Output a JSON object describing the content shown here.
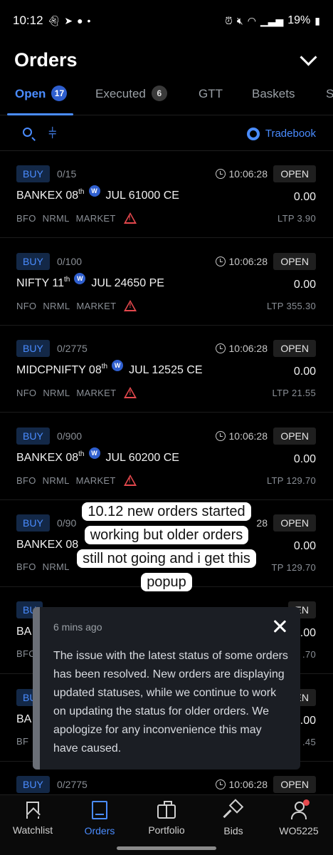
{
  "status_bar": {
    "time": "10:12",
    "battery": "19%",
    "left_icons": [
      "snapchat-icon",
      "telegram-icon",
      "chat-icon",
      "dot-icon"
    ],
    "right_icons": [
      "alarm-icon",
      "mute-icon",
      "wifi-icon",
      "volte-icon",
      "signal-icon",
      "battery-icon"
    ]
  },
  "header": {
    "title": "Orders"
  },
  "tabs": [
    {
      "label": "Open",
      "count": "17"
    },
    {
      "label": "Executed",
      "count": "6"
    },
    {
      "label": "GTT"
    },
    {
      "label": "Baskets"
    },
    {
      "label": "S"
    }
  ],
  "toolbar": {
    "tradebook_label": "Tradebook"
  },
  "orders": [
    {
      "side": "BUY",
      "qty": "0/15",
      "time": "10:06:28",
      "status": "OPEN",
      "symbol": "BANKEX 08",
      "suffix": "th",
      "badge": "W",
      "contract": "JUL 61000 CE",
      "price": "0.00",
      "exchange": "BFO",
      "product": "NRML",
      "type": "MARKET",
      "ltp_label": "LTP",
      "ltp": "3.90"
    },
    {
      "side": "BUY",
      "qty": "0/100",
      "time": "10:06:28",
      "status": "OPEN",
      "symbol": "NIFTY 11",
      "suffix": "th",
      "badge": "W",
      "contract": "JUL 24650 PE",
      "price": "0.00",
      "exchange": "NFO",
      "product": "NRML",
      "type": "MARKET",
      "ltp_label": "LTP",
      "ltp": "355.30"
    },
    {
      "side": "BUY",
      "qty": "0/2775",
      "time": "10:06:28",
      "status": "OPEN",
      "symbol": "MIDCPNIFTY 08",
      "suffix": "th",
      "badge": "W",
      "contract": "JUL 12525 CE",
      "price": "0.00",
      "exchange": "NFO",
      "product": "NRML",
      "type": "MARKET",
      "ltp_label": "LTP",
      "ltp": "21.55"
    },
    {
      "side": "BUY",
      "qty": "0/900",
      "time": "10:06:28",
      "status": "OPEN",
      "symbol": "BANKEX 08",
      "suffix": "th",
      "badge": "W",
      "contract": "JUL 60200 CE",
      "price": "0.00",
      "exchange": "BFO",
      "product": "NRML",
      "type": "MARKET",
      "ltp_label": "LTP",
      "ltp": "129.70"
    },
    {
      "side": "BUY",
      "qty": "0/90",
      "time": "28",
      "status": "OPEN",
      "symbol": "BANKEX 08",
      "suffix": "",
      "badge": "",
      "contract": "",
      "price": "0.00",
      "exchange": "BFO",
      "product": "NRML",
      "type": "",
      "ltp_label": "TP",
      "ltp": "129.70"
    },
    {
      "side": "BU",
      "qty": "",
      "time": "",
      "status": "EN",
      "symbol": "BA",
      "suffix": "",
      "badge": "",
      "contract": "",
      "price": ".00",
      "exchange": "BFO",
      "product": "",
      "type": "",
      "ltp_label": "",
      "ltp": ".70"
    },
    {
      "side": "BU",
      "qty": "",
      "time": "",
      "status": "EN",
      "symbol": "BA",
      "suffix": "",
      "badge": "",
      "contract": "",
      "price": ".00",
      "exchange": "BF",
      "product": "",
      "type": "",
      "ltp_label": "",
      "ltp": ".45"
    },
    {
      "side": "BUY",
      "qty": "0/2775",
      "time": "10:06:28",
      "status": "OPEN"
    }
  ],
  "caption": {
    "lines": [
      "10.12 new orders started",
      "working but older orders",
      "still not going and i get this",
      "popup"
    ]
  },
  "popup": {
    "time": "6 mins ago",
    "message": "The issue with the latest status of some orders has been resolved. New orders are displaying updated statuses, while we continue to work on updating the status for older orders. We apologize for any inconvenience this may have caused."
  },
  "bottom_nav": [
    {
      "label": "Watchlist",
      "icon": "bookmark-icon"
    },
    {
      "label": "Orders",
      "icon": "book-icon",
      "active": true
    },
    {
      "label": "Portfolio",
      "icon": "briefcase-icon"
    },
    {
      "label": "Bids",
      "icon": "gavel-icon"
    },
    {
      "label": "WO5225",
      "icon": "user-icon"
    }
  ],
  "colors": {
    "accent": "#4a8cff",
    "warning": "#e5484d",
    "background": "#000000"
  }
}
